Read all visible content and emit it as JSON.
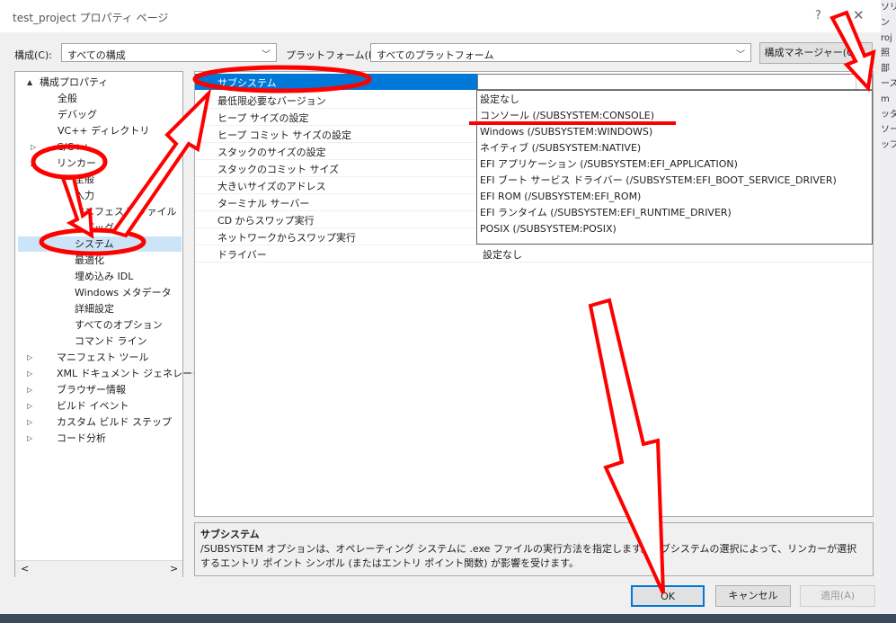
{
  "window": {
    "title": "test_project プロパティ ページ",
    "help": "?",
    "close": "✕"
  },
  "toolbar": {
    "config_label": "構成(C):",
    "config_value": "すべての構成",
    "platform_label": "プラットフォーム(P):",
    "platform_value": "すべてのプラットフォーム",
    "config_manager_button": "構成マネージャー(O)..."
  },
  "tree": {
    "items": [
      {
        "label": "構成プロパティ",
        "arrow": "▲"
      },
      {
        "label": "全般",
        "arrow": ""
      },
      {
        "label": "デバッグ",
        "arrow": ""
      },
      {
        "label": "VC++ ディレクトリ",
        "arrow": ""
      },
      {
        "label": "C/C++",
        "arrow": "▷"
      },
      {
        "label": "リンカー",
        "arrow": "▲"
      },
      {
        "label": "全般",
        "arrow": ""
      },
      {
        "label": "入力",
        "arrow": ""
      },
      {
        "label": "マニフェスト ファイル",
        "arrow": ""
      },
      {
        "label": "デバッグ",
        "arrow": ""
      },
      {
        "label": "システム",
        "arrow": ""
      },
      {
        "label": "最適化",
        "arrow": ""
      },
      {
        "label": "埋め込み IDL",
        "arrow": ""
      },
      {
        "label": "Windows メタデータ",
        "arrow": ""
      },
      {
        "label": "詳細設定",
        "arrow": ""
      },
      {
        "label": "すべてのオプション",
        "arrow": ""
      },
      {
        "label": "コマンド ライン",
        "arrow": ""
      },
      {
        "label": "マニフェスト ツール",
        "arrow": "▷"
      },
      {
        "label": "XML ドキュメント ジェネレーター",
        "arrow": "▷"
      },
      {
        "label": "ブラウザー情報",
        "arrow": "▷"
      },
      {
        "label": "ビルド イベント",
        "arrow": "▷"
      },
      {
        "label": "カスタム ビルド ステップ",
        "arrow": "▷"
      },
      {
        "label": "コード分析",
        "arrow": "▷"
      }
    ],
    "scroll_left": "<",
    "scroll_right": ">"
  },
  "grid": {
    "selected_name": "サブシステム",
    "rows": [
      {
        "name": "最低限必要なバージョン",
        "value": ""
      },
      {
        "name": "ヒープ サイズの設定",
        "value": ""
      },
      {
        "name": "ヒープ コミット サイズの設定",
        "value": ""
      },
      {
        "name": "スタックのサイズの設定",
        "value": ""
      },
      {
        "name": "スタックのコミット サイズ",
        "value": ""
      },
      {
        "name": "大きいサイズのアドレス",
        "value": ""
      },
      {
        "name": "ターミナル サーバー",
        "value": ""
      },
      {
        "name": "CD からスワップ実行",
        "value": ""
      },
      {
        "name": "ネットワークからスワップ実行",
        "value": ""
      },
      {
        "name": "ドライバー",
        "value": "設定なし"
      }
    ],
    "dropdown_options": [
      "設定なし",
      "コンソール (/SUBSYSTEM:CONSOLE)",
      "Windows (/SUBSYSTEM:WINDOWS)",
      "ネイティブ (/SUBSYSTEM:NATIVE)",
      "EFI アプリケーション (/SUBSYSTEM:EFI_APPLICATION)",
      "EFI ブート サービス ドライバー (/SUBSYSTEM:EFI_BOOT_SERVICE_DRIVER)",
      "EFI ROM (/SUBSYSTEM:EFI_ROM)",
      "EFI ランタイム (/SUBSYSTEM:EFI_RUNTIME_DRIVER)",
      "POSIX (/SUBSYSTEM:POSIX)"
    ]
  },
  "description": {
    "title": "サブシステム",
    "text": "/SUBSYSTEM オプションは、オペレーティング システムに .exe ファイルの実行方法を指定します。サブシステムの選択によって、リンカーが選択するエントリ ポイント シンボル (またはエントリ ポイント関数) が影響を受けます。"
  },
  "buttons": {
    "ok": "OK",
    "cancel": "キャンセル",
    "apply": "適用(A)"
  },
  "background_app": {
    "lines": [
      "ソリューション",
      "ン",
      "roj",
      "照",
      "部",
      "ース",
      "m",
      "ッダ",
      "ソー",
      "",
      "",
      "",
      "",
      "",
      "",
      "",
      "",
      "",
      "",
      "",
      "",
      "",
      "",
      "",
      "",
      "",
      "",
      "",
      "ップス"
    ]
  },
  "colors": {
    "selection": "#0078d7",
    "tree_selection": "#cce4f7",
    "annotation": "#ff0000"
  }
}
